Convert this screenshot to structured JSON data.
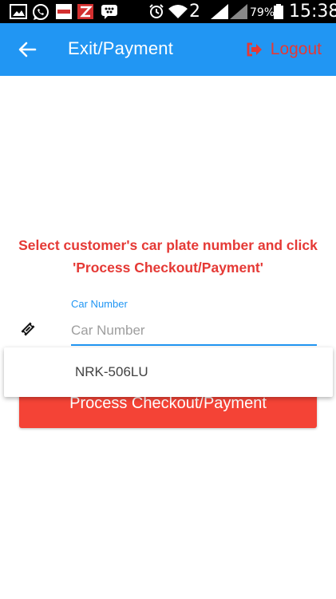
{
  "status_bar": {
    "battery_percent": "79%",
    "time": "15:38",
    "sim_slot": "2",
    "left_icons": [
      "gallery-icon",
      "whatsapp-icon",
      "punch-icon",
      "zenith-icon",
      "bbm-icon"
    ],
    "right_icons": [
      "alarm-icon",
      "wifi-icon",
      "signal-icon",
      "battery-icon"
    ]
  },
  "app_bar": {
    "title": "Exit/Payment",
    "logout_label": "Logout",
    "back_icon": "arrow-left-icon",
    "logout_icon": "sign-out-icon",
    "background_color": "#2196f3",
    "logout_color": "#e53935"
  },
  "main": {
    "instruction_line1": "Select customer's car plate number and click",
    "instruction_line2": "'Process Checkout/Payment'",
    "car_field": {
      "label": "Car Number",
      "placeholder": "Car Number",
      "value": "",
      "icon": "ticket-icon"
    },
    "suggestions": [
      "NRK-506LU"
    ],
    "process_button_label": "Process Checkout/Payment",
    "button_color": "#f44336",
    "accent_color": "#2196f3"
  }
}
